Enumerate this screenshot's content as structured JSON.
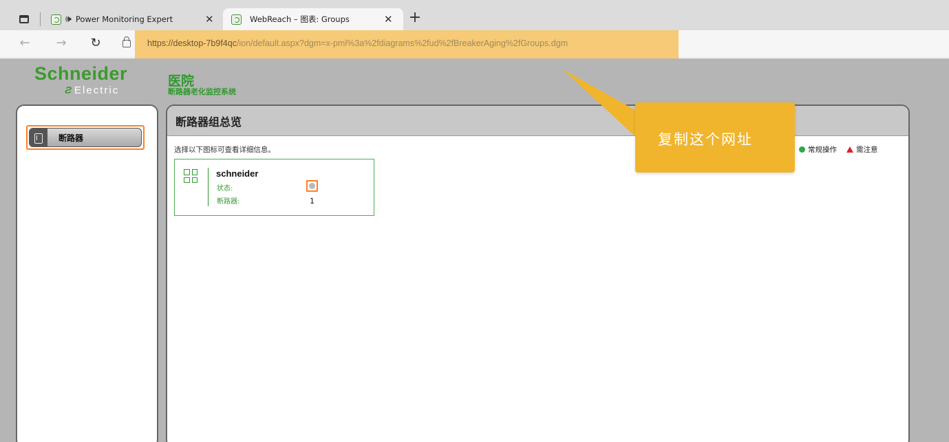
{
  "browser": {
    "tabs": [
      {
        "label": "Power Monitoring Expert",
        "active": false
      },
      {
        "label": "WebReach – 图表: Groups",
        "active": true
      }
    ],
    "url_host": "https://desktop-7b9f4qc",
    "url_path": "/ion/default.aspx?dgm=x-pml%3a%2fdiagrams%2fud%2fBreakerAging%2fGroups.dgm"
  },
  "header": {
    "logo_main": "Schneider",
    "logo_sub": "Electric",
    "site_title": "医院",
    "site_subtitle": "断路器老化监控系统"
  },
  "sidebar": {
    "items": [
      {
        "label": "断路器",
        "selected": true
      }
    ]
  },
  "main": {
    "title": "断路器组总览",
    "instruction": "选择以下图标可查看详细信息。",
    "legend": {
      "normal": "常规操作",
      "attention": "需注意",
      "normal_color": "#2aa84a",
      "attention_color": "#e0202a"
    },
    "group": {
      "name": "schneider",
      "status_label": "状态:",
      "breaker_label": "断路器:",
      "breaker_count": "1"
    }
  },
  "callout": {
    "text": "复制这个网址",
    "color": "#f0b52d"
  },
  "colors": {
    "brand_green": "#3c9a2e",
    "highlight_orange": "#ff7f27"
  }
}
